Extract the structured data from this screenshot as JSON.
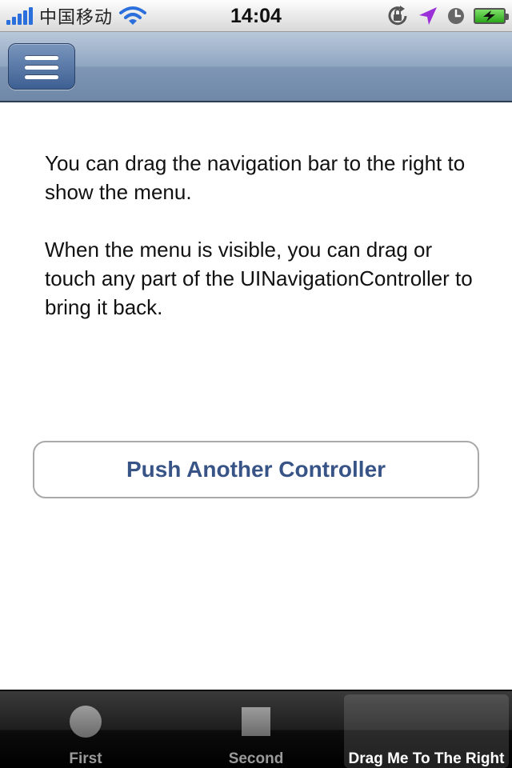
{
  "status_bar": {
    "carrier": "中国移动",
    "time": "14:04",
    "icons": [
      "signal-icon",
      "wifi-icon",
      "rotation-lock-icon",
      "location-icon",
      "alarm-icon",
      "battery-icon"
    ]
  },
  "nav_bar": {
    "menu_icon": "hamburger-menu-icon"
  },
  "content": {
    "paragraph1": "You can drag the navigation bar to the right to show the menu.",
    "paragraph2": "When the menu is visible, you can drag or touch any part of the UINavigationController to bring it back.",
    "push_button_label": "Push Another Controller"
  },
  "tab_bar": {
    "selected_index": 2,
    "tabs": [
      {
        "label": "First",
        "icon": "circle-icon"
      },
      {
        "label": "Second",
        "icon": "square-icon"
      },
      {
        "label": "Drag Me To The Right",
        "icon": ""
      }
    ]
  },
  "colors": {
    "nav_bar": "#8fa6c1",
    "menu_button": "#4a6ba0",
    "button_text": "#385487",
    "battery_fill": "#3fbf2a",
    "location_arrow": "#9b30d9",
    "signal": "#2a6fdb"
  }
}
